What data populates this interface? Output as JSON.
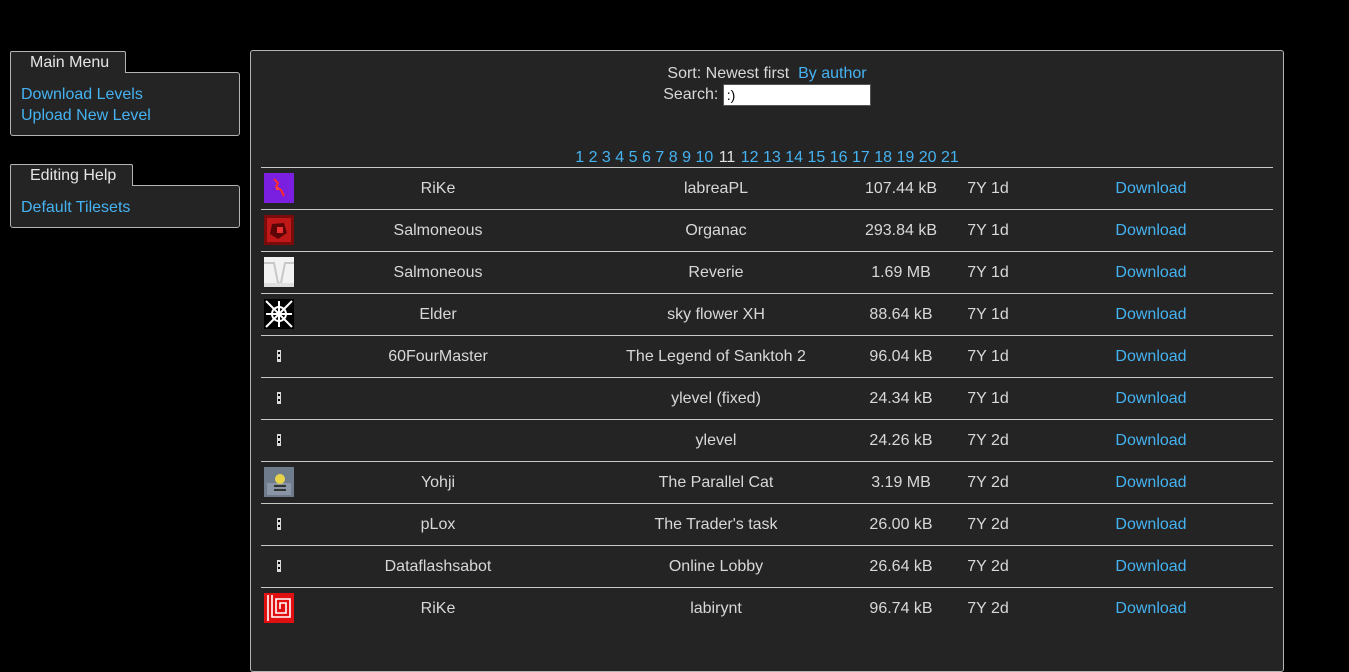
{
  "sidebar": {
    "main_menu": {
      "title": "Main Menu",
      "links": [
        "Download Levels",
        "Upload New Level"
      ]
    },
    "editing_help": {
      "title": "Editing Help",
      "links": [
        "Default Tilesets"
      ]
    }
  },
  "sort": {
    "label": "Sort:",
    "current": "Newest first",
    "alt_link": "By author"
  },
  "search": {
    "label": "Search:",
    "value": ":)"
  },
  "pager": {
    "pages": [
      "1",
      "2",
      "3",
      "4",
      "5",
      "6",
      "7",
      "8",
      "9",
      "10",
      "11",
      "12",
      "13",
      "14",
      "15",
      "16",
      "17",
      "18",
      "19",
      "20",
      "21"
    ],
    "current": "11"
  },
  "rows": [
    {
      "thumb": "purple-thumb",
      "author": "RiKe",
      "title": "labreaPL",
      "size": "107.44 kB",
      "age": "7Y 1d",
      "download": "Download"
    },
    {
      "thumb": "red-thumb",
      "author": "Salmoneous",
      "title": "Organac",
      "size": "293.84 kB",
      "age": "7Y 1d",
      "download": "Download"
    },
    {
      "thumb": "white-thumb",
      "author": "Salmoneous",
      "title": "Reverie",
      "size": "1.69 MB",
      "age": "7Y 1d",
      "download": "Download"
    },
    {
      "thumb": "pattern-thumb",
      "author": "Elder",
      "title": "sky flower XH",
      "size": "88.64 kB",
      "age": "7Y 1d",
      "download": "Download"
    },
    {
      "thumb": "default-thumb",
      "author": "60FourMaster",
      "title": "The Legend of Sanktoh 2",
      "size": "96.04 kB",
      "age": "7Y 1d",
      "download": "Download"
    },
    {
      "thumb": "default-thumb",
      "author": "",
      "title": "ylevel (fixed)",
      "size": "24.34 kB",
      "age": "7Y 1d",
      "download": "Download"
    },
    {
      "thumb": "default-thumb",
      "author": "",
      "title": "ylevel",
      "size": "24.26 kB",
      "age": "7Y 2d",
      "download": "Download"
    },
    {
      "thumb": "cat-thumb",
      "author": "Yohji",
      "title": "The Parallel Cat",
      "size": "3.19 MB",
      "age": "7Y 2d",
      "download": "Download"
    },
    {
      "thumb": "default-thumb",
      "author": "pLox",
      "title": "The Trader's task",
      "size": "26.00 kB",
      "age": "7Y 2d",
      "download": "Download"
    },
    {
      "thumb": "default-thumb",
      "author": "Dataflashsabot",
      "title": "Online Lobby",
      "size": "26.64 kB",
      "age": "7Y 2d",
      "download": "Download"
    },
    {
      "thumb": "maze-thumb",
      "author": "RiKe",
      "title": "labirynt",
      "size": "96.74 kB",
      "age": "7Y 2d",
      "download": "Download"
    }
  ],
  "colors": {
    "background": "#000000",
    "panel": "#242424",
    "link": "#45b3f2",
    "border": "#b4b4b4"
  }
}
